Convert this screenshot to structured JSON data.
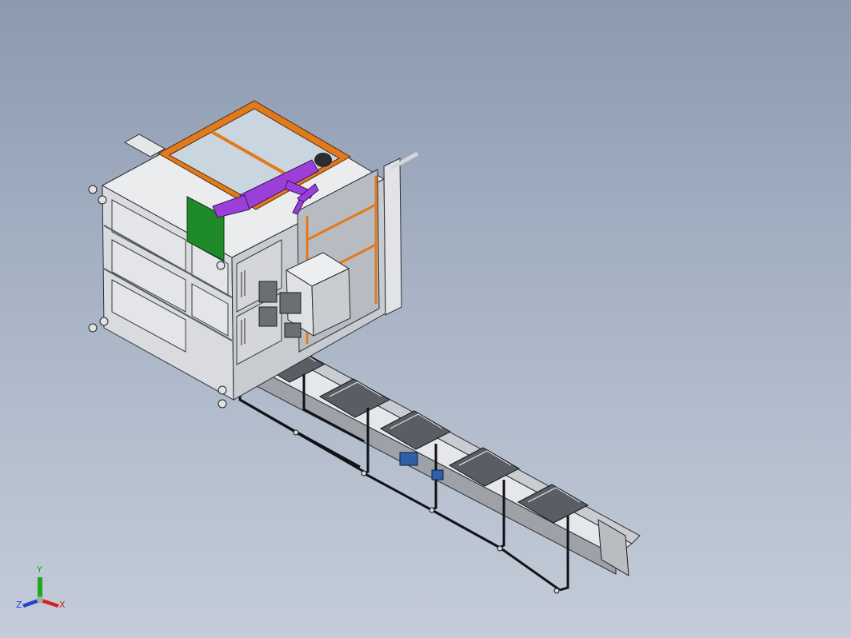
{
  "viewport": {
    "background_top": "#8c9aaf",
    "background_bottom": "#c4ccd8"
  },
  "model": {
    "cabinet_color": "#d9dbde",
    "frame_color": "#e07a1f",
    "mannequin_color": "#9b3fd9",
    "panel_color": "#1f8a2a",
    "conveyor_color": "#3a3d42",
    "motor_color": "#2e5fa8"
  },
  "triad": {
    "x_label": "X",
    "y_label": "Y",
    "z_label": "Z",
    "x_color": "#d42020",
    "y_color": "#1ea81e",
    "z_color": "#2040d0"
  }
}
